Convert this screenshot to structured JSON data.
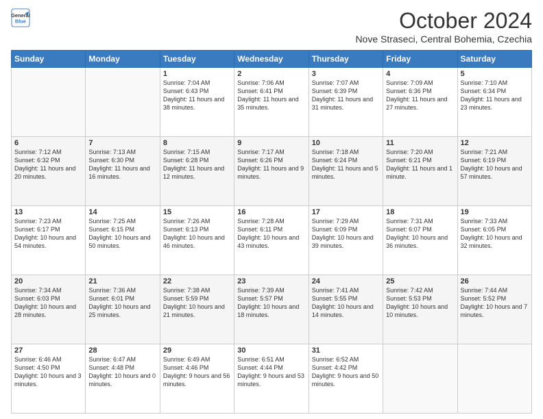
{
  "logo": {
    "general": "General",
    "blue": "Blue"
  },
  "header": {
    "month": "October 2024",
    "location": "Nove Straseci, Central Bohemia, Czechia"
  },
  "days": [
    "Sunday",
    "Monday",
    "Tuesday",
    "Wednesday",
    "Thursday",
    "Friday",
    "Saturday"
  ],
  "weeks": [
    [
      {
        "day": "",
        "sunrise": "",
        "sunset": "",
        "daylight": ""
      },
      {
        "day": "",
        "sunrise": "",
        "sunset": "",
        "daylight": ""
      },
      {
        "day": "1",
        "sunrise": "Sunrise: 7:04 AM",
        "sunset": "Sunset: 6:43 PM",
        "daylight": "Daylight: 11 hours and 38 minutes."
      },
      {
        "day": "2",
        "sunrise": "Sunrise: 7:06 AM",
        "sunset": "Sunset: 6:41 PM",
        "daylight": "Daylight: 11 hours and 35 minutes."
      },
      {
        "day": "3",
        "sunrise": "Sunrise: 7:07 AM",
        "sunset": "Sunset: 6:39 PM",
        "daylight": "Daylight: 11 hours and 31 minutes."
      },
      {
        "day": "4",
        "sunrise": "Sunrise: 7:09 AM",
        "sunset": "Sunset: 6:36 PM",
        "daylight": "Daylight: 11 hours and 27 minutes."
      },
      {
        "day": "5",
        "sunrise": "Sunrise: 7:10 AM",
        "sunset": "Sunset: 6:34 PM",
        "daylight": "Daylight: 11 hours and 23 minutes."
      }
    ],
    [
      {
        "day": "6",
        "sunrise": "Sunrise: 7:12 AM",
        "sunset": "Sunset: 6:32 PM",
        "daylight": "Daylight: 11 hours and 20 minutes."
      },
      {
        "day": "7",
        "sunrise": "Sunrise: 7:13 AM",
        "sunset": "Sunset: 6:30 PM",
        "daylight": "Daylight: 11 hours and 16 minutes."
      },
      {
        "day": "8",
        "sunrise": "Sunrise: 7:15 AM",
        "sunset": "Sunset: 6:28 PM",
        "daylight": "Daylight: 11 hours and 12 minutes."
      },
      {
        "day": "9",
        "sunrise": "Sunrise: 7:17 AM",
        "sunset": "Sunset: 6:26 PM",
        "daylight": "Daylight: 11 hours and 9 minutes."
      },
      {
        "day": "10",
        "sunrise": "Sunrise: 7:18 AM",
        "sunset": "Sunset: 6:24 PM",
        "daylight": "Daylight: 11 hours and 5 minutes."
      },
      {
        "day": "11",
        "sunrise": "Sunrise: 7:20 AM",
        "sunset": "Sunset: 6:21 PM",
        "daylight": "Daylight: 11 hours and 1 minute."
      },
      {
        "day": "12",
        "sunrise": "Sunrise: 7:21 AM",
        "sunset": "Sunset: 6:19 PM",
        "daylight": "Daylight: 10 hours and 57 minutes."
      }
    ],
    [
      {
        "day": "13",
        "sunrise": "Sunrise: 7:23 AM",
        "sunset": "Sunset: 6:17 PM",
        "daylight": "Daylight: 10 hours and 54 minutes."
      },
      {
        "day": "14",
        "sunrise": "Sunrise: 7:25 AM",
        "sunset": "Sunset: 6:15 PM",
        "daylight": "Daylight: 10 hours and 50 minutes."
      },
      {
        "day": "15",
        "sunrise": "Sunrise: 7:26 AM",
        "sunset": "Sunset: 6:13 PM",
        "daylight": "Daylight: 10 hours and 46 minutes."
      },
      {
        "day": "16",
        "sunrise": "Sunrise: 7:28 AM",
        "sunset": "Sunset: 6:11 PM",
        "daylight": "Daylight: 10 hours and 43 minutes."
      },
      {
        "day": "17",
        "sunrise": "Sunrise: 7:29 AM",
        "sunset": "Sunset: 6:09 PM",
        "daylight": "Daylight: 10 hours and 39 minutes."
      },
      {
        "day": "18",
        "sunrise": "Sunrise: 7:31 AM",
        "sunset": "Sunset: 6:07 PM",
        "daylight": "Daylight: 10 hours and 36 minutes."
      },
      {
        "day": "19",
        "sunrise": "Sunrise: 7:33 AM",
        "sunset": "Sunset: 6:05 PM",
        "daylight": "Daylight: 10 hours and 32 minutes."
      }
    ],
    [
      {
        "day": "20",
        "sunrise": "Sunrise: 7:34 AM",
        "sunset": "Sunset: 6:03 PM",
        "daylight": "Daylight: 10 hours and 28 minutes."
      },
      {
        "day": "21",
        "sunrise": "Sunrise: 7:36 AM",
        "sunset": "Sunset: 6:01 PM",
        "daylight": "Daylight: 10 hours and 25 minutes."
      },
      {
        "day": "22",
        "sunrise": "Sunrise: 7:38 AM",
        "sunset": "Sunset: 5:59 PM",
        "daylight": "Daylight: 10 hours and 21 minutes."
      },
      {
        "day": "23",
        "sunrise": "Sunrise: 7:39 AM",
        "sunset": "Sunset: 5:57 PM",
        "daylight": "Daylight: 10 hours and 18 minutes."
      },
      {
        "day": "24",
        "sunrise": "Sunrise: 7:41 AM",
        "sunset": "Sunset: 5:55 PM",
        "daylight": "Daylight: 10 hours and 14 minutes."
      },
      {
        "day": "25",
        "sunrise": "Sunrise: 7:42 AM",
        "sunset": "Sunset: 5:53 PM",
        "daylight": "Daylight: 10 hours and 10 minutes."
      },
      {
        "day": "26",
        "sunrise": "Sunrise: 7:44 AM",
        "sunset": "Sunset: 5:52 PM",
        "daylight": "Daylight: 10 hours and 7 minutes."
      }
    ],
    [
      {
        "day": "27",
        "sunrise": "Sunrise: 6:46 AM",
        "sunset": "Sunset: 4:50 PM",
        "daylight": "Daylight: 10 hours and 3 minutes."
      },
      {
        "day": "28",
        "sunrise": "Sunrise: 6:47 AM",
        "sunset": "Sunset: 4:48 PM",
        "daylight": "Daylight: 10 hours and 0 minutes."
      },
      {
        "day": "29",
        "sunrise": "Sunrise: 6:49 AM",
        "sunset": "Sunset: 4:46 PM",
        "daylight": "Daylight: 9 hours and 56 minutes."
      },
      {
        "day": "30",
        "sunrise": "Sunrise: 6:51 AM",
        "sunset": "Sunset: 4:44 PM",
        "daylight": "Daylight: 9 hours and 53 minutes."
      },
      {
        "day": "31",
        "sunrise": "Sunrise: 6:52 AM",
        "sunset": "Sunset: 4:42 PM",
        "daylight": "Daylight: 9 hours and 50 minutes."
      },
      {
        "day": "",
        "sunrise": "",
        "sunset": "",
        "daylight": ""
      },
      {
        "day": "",
        "sunrise": "",
        "sunset": "",
        "daylight": ""
      }
    ]
  ]
}
